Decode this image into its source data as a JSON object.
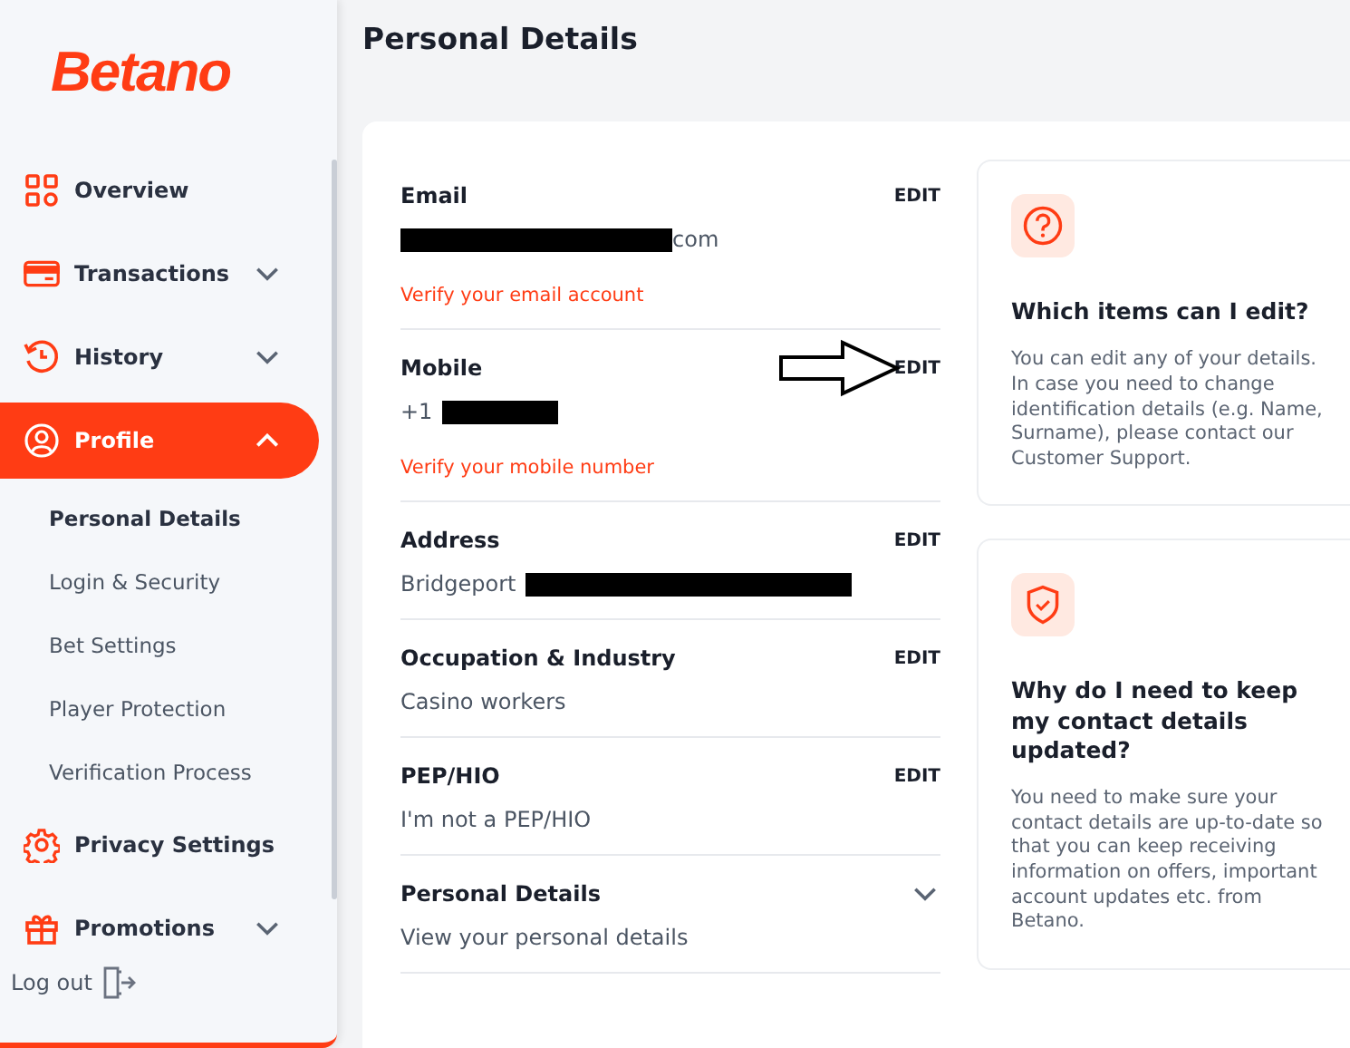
{
  "logo": "Betano",
  "nav": [
    {
      "label": "Overview",
      "kind": "grid",
      "selected": false
    },
    {
      "label": "Transactions",
      "kind": "card",
      "expanded": false,
      "selected": false
    },
    {
      "label": "History",
      "kind": "history",
      "expanded": false,
      "selected": false
    },
    {
      "label": "Profile",
      "kind": "user",
      "expanded": true,
      "selected": true,
      "children": [
        {
          "label": "Personal Details",
          "selected": true
        },
        {
          "label": "Login & Security",
          "selected": false
        },
        {
          "label": "Bet Settings",
          "selected": false
        },
        {
          "label": "Player Protection",
          "selected": false
        },
        {
          "label": "Verification Process",
          "selected": false
        }
      ]
    },
    {
      "label": "Privacy Settings",
      "kind": "gear",
      "selected": false
    },
    {
      "label": "Promotions",
      "kind": "gift",
      "expanded": false,
      "selected": false
    }
  ],
  "logout": "Log out",
  "page_title": "Personal Details",
  "details": [
    {
      "kind": "edit",
      "label": "Email",
      "action": "EDIT",
      "redacted": true,
      "value": "com",
      "warning": "Verify your email account",
      "arrow": false
    },
    {
      "kind": "edit",
      "label": "Mobile",
      "action": "EDIT",
      "value_before": "+1",
      "redacted": true,
      "warning": "Verify your mobile number",
      "arrow": true
    },
    {
      "kind": "edit",
      "label": "Address",
      "action": "EDIT",
      "value_before": "Bridgeport",
      "redacted": true,
      "arrow": false
    },
    {
      "kind": "edit",
      "label": "Occupation & Industry",
      "action": "EDIT",
      "value": "Casino workers",
      "redacted": false,
      "arrow": false
    },
    {
      "kind": "edit",
      "label": "PEP/HIO",
      "action": "EDIT",
      "value": "I'm not a PEP/HIO",
      "redacted": false,
      "arrow": false
    },
    {
      "kind": "expand",
      "label": "Personal Details",
      "value": "View your personal details",
      "redacted": false,
      "arrow": false
    }
  ],
  "info_cards": [
    {
      "kind": "question",
      "title": "Which items can I edit?",
      "text": "You can edit any of your details. In case you need to change identification details (e.g. Name, Surname), please contact our Customer Support."
    },
    {
      "kind": "shield",
      "title": "Why do I need to keep my contact details updated?",
      "text": "You need to make sure your contact details are up-to-date so that you can keep receiving information on offers, important account updates etc. from Betano."
    }
  ]
}
